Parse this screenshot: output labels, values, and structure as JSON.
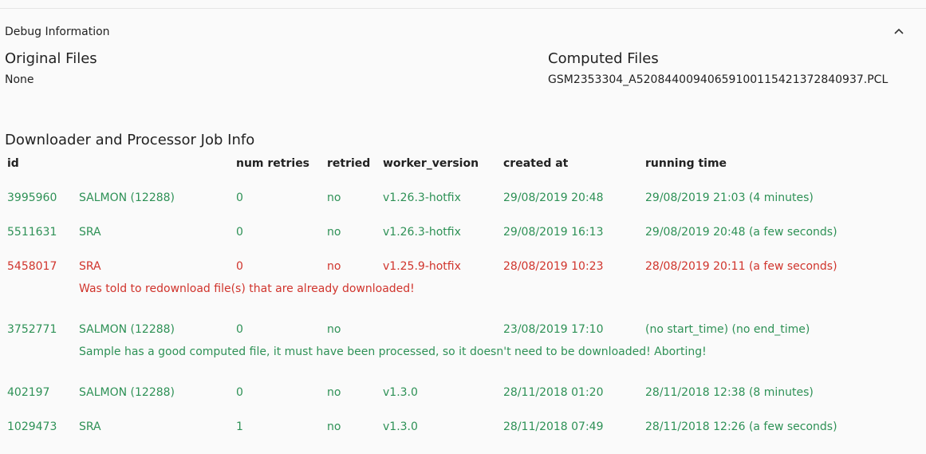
{
  "debug": {
    "title": "Debug Information",
    "toggle_icon": "chevron-up-icon"
  },
  "files": {
    "original_heading": "Original Files",
    "original_value": "None",
    "computed_heading": "Computed Files",
    "computed_value": "GSM2353304_A52084400940659100115421372840937.PCL"
  },
  "jobs": {
    "heading": "Downloader and Processor Job Info",
    "columns": [
      "id",
      "num retries",
      "retried",
      "worker_version",
      "created at",
      "running time"
    ],
    "rows": [
      {
        "id": "3995960",
        "type": "SALMON (12288)",
        "num_retries": "0",
        "retried": "no",
        "worker_version": "v1.26.3-hotfix",
        "created_at": "29/08/2019 20:48",
        "running_time": "29/08/2019 21:03 (4 minutes)",
        "status": "ok",
        "message": ""
      },
      {
        "id": "5511631",
        "type": "SRA",
        "num_retries": "0",
        "retried": "no",
        "worker_version": "v1.26.3-hotfix",
        "created_at": "29/08/2019 16:13",
        "running_time": "29/08/2019 20:48 (a few seconds)",
        "status": "ok",
        "message": ""
      },
      {
        "id": "5458017",
        "type": "SRA",
        "num_retries": "0",
        "retried": "no",
        "worker_version": "v1.25.9-hotfix",
        "created_at": "28/08/2019 10:23",
        "running_time": "28/08/2019 20:11 (a few seconds)",
        "status": "failed",
        "message": "Was told to redownload file(s) that are already downloaded!"
      },
      {
        "id": "3752771",
        "type": "SALMON (12288)",
        "num_retries": "0",
        "retried": "no",
        "worker_version": "",
        "created_at": "23/08/2019 17:10",
        "running_time": "(no start_time) (no end_time)",
        "status": "ok",
        "message": "Sample has a good computed file, it must have been processed, so it doesn't need to be downloaded! Aborting!"
      },
      {
        "id": "402197",
        "type": "SALMON (12288)",
        "num_retries": "0",
        "retried": "no",
        "worker_version": "v1.3.0",
        "created_at": "28/11/2018 01:20",
        "running_time": "28/11/2018 12:38 (8 minutes)",
        "status": "ok",
        "message": ""
      },
      {
        "id": "1029473",
        "type": "SRA",
        "num_retries": "1",
        "retried": "no",
        "worker_version": "v1.3.0",
        "created_at": "28/11/2018 07:49",
        "running_time": "28/11/2018 12:26 (a few seconds)",
        "status": "ok",
        "message": ""
      }
    ]
  },
  "colors": {
    "ok": "#2e9156",
    "failed": "#d0342c",
    "text": "#222222"
  }
}
